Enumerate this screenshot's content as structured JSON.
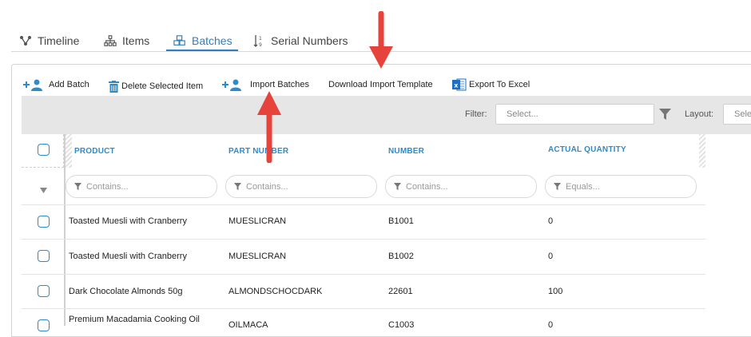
{
  "tabs": [
    {
      "label": "Timeline",
      "icon": "timeline-icon"
    },
    {
      "label": "Items",
      "icon": "hierarchy-icon"
    },
    {
      "label": "Batches",
      "icon": "batches-icon",
      "active": true
    },
    {
      "label": "Serial Numbers",
      "icon": "sort-numeric-icon"
    }
  ],
  "toolbar": {
    "add_batch": "Add Batch",
    "delete_selected": "Delete Selected Item",
    "import_batches": "Import Batches",
    "download_template": "Download Import Template",
    "export_excel": "Export To Excel"
  },
  "filterbar": {
    "filter_label": "Filter:",
    "filter_placeholder": "Select...",
    "layout_label": "Layout:",
    "layout_placeholder": "Sele"
  },
  "grid": {
    "columns": [
      {
        "header": "PRODUCT",
        "filter_placeholder": "Contains..."
      },
      {
        "header": "PART NUMBER",
        "filter_placeholder": "Contains..."
      },
      {
        "header": "NUMBER",
        "filter_placeholder": "Contains..."
      },
      {
        "header": "ACTUAL QUANTITY",
        "filter_placeholder": "Equals..."
      }
    ],
    "rows": [
      {
        "product": "Toasted Muesli with Cranberry",
        "part_number": "MUESLICRAN",
        "number": "B1001",
        "actual_quantity": "0"
      },
      {
        "product": "Toasted Muesli with Cranberry",
        "part_number": "MUESLICRAN",
        "number": "B1002",
        "actual_quantity": "0"
      },
      {
        "product": "Dark Chocolate Almonds 50g",
        "part_number": "ALMONDSCHOCDARK",
        "number": "22601",
        "actual_quantity": "100"
      },
      {
        "product": "Premium Macadamia Cooking Oil",
        "part_number": "OILMACA",
        "number": "C1003",
        "actual_quantity": "0"
      }
    ]
  },
  "colors": {
    "accent": "#2f7fbf",
    "header_text": "#2e8bcb",
    "annotation_arrow": "#e5433b",
    "excel_green": "#1e6fc2"
  }
}
